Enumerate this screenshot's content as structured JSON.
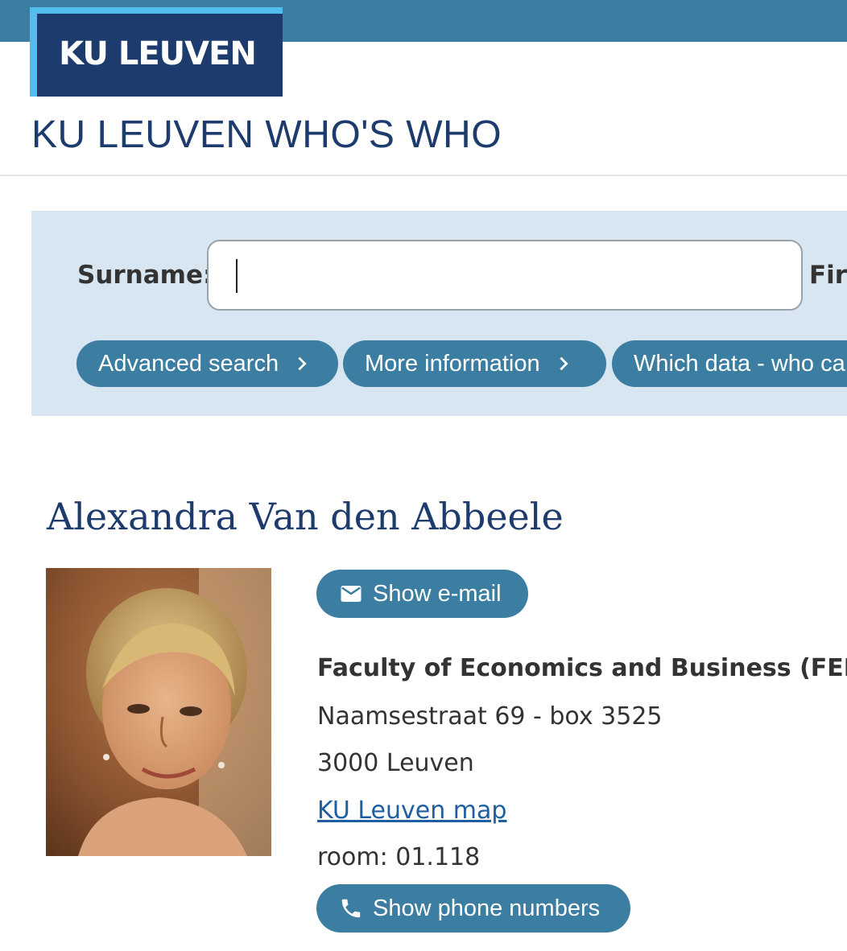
{
  "header": {
    "logo_text": "KU LEUVEN",
    "site_title": "KU LEUVEN WHO'S WHO"
  },
  "search": {
    "surname_label": "Surname:",
    "surname_value": "",
    "firstname_label": "Firs",
    "buttons": [
      {
        "label": "Advanced search"
      },
      {
        "label": "More information"
      },
      {
        "label": "Which data - who ca"
      }
    ]
  },
  "person": {
    "name": "Alexandra Van den Abbeele",
    "show_email_label": "Show e-mail",
    "department": "Faculty of Economics and Business (FEB)",
    "address_line1": "Naamsestraat 69 - box 3525",
    "address_line2": "3000 Leuven",
    "map_link": "KU Leuven map",
    "room": "room: 01.118",
    "show_phone_label": "Show phone numbers"
  },
  "colors": {
    "brand_dark": "#1d3b6d",
    "brand_accent": "#3b7ea1",
    "brand_light": "#52bdec",
    "panel_bg": "#d7e6f0"
  },
  "icons": [
    "chevron-right-icon",
    "mail-icon",
    "phone-icon"
  ]
}
